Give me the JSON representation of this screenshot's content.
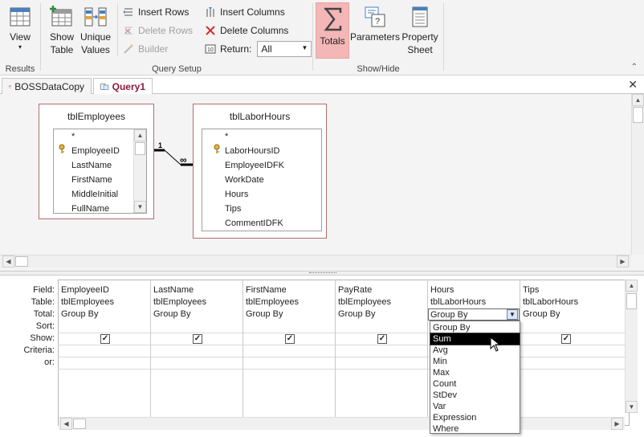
{
  "ribbon": {
    "results": {
      "label": "Results",
      "view": "View"
    },
    "query_setup": {
      "label": "Query Setup",
      "show_table": [
        "Show",
        "Table"
      ],
      "unique_values": [
        "Unique",
        "Values"
      ],
      "insert_rows": "Insert Rows",
      "delete_rows": "Delete Rows",
      "builder": "Builder",
      "insert_columns": "Insert Columns",
      "delete_columns": "Delete Columns",
      "return_label": "Return:",
      "return_value": "All"
    },
    "show_hide": {
      "label": "Show/Hide",
      "totals": "Totals",
      "parameters": "Parameters",
      "property_sheet": [
        "Property",
        "Sheet"
      ]
    }
  },
  "doc_tabs": [
    {
      "label": "BOSSDataCopy",
      "active": false
    },
    {
      "label": "Query1",
      "active": true
    }
  ],
  "tables": [
    {
      "title": "tblEmployees",
      "fields": [
        "*",
        "EmployeeID",
        "LastName",
        "FirstName",
        "MiddleInitial",
        "FullName"
      ],
      "key_field": "EmployeeID"
    },
    {
      "title": "tblLaborHours",
      "fields": [
        "*",
        "LaborHoursID",
        "EmployeeIDFK",
        "WorkDate",
        "Hours",
        "Tips",
        "CommentIDFK"
      ],
      "key_field": "LaborHoursID"
    }
  ],
  "relationship": {
    "one": "1",
    "many": "∞"
  },
  "grid": {
    "row_labels": [
      "Field:",
      "Table:",
      "Total:",
      "Sort:",
      "Show:",
      "Criteria:",
      "or:"
    ],
    "columns": [
      {
        "field": "EmployeeID",
        "table": "tblEmployees",
        "total": "Group By",
        "show": true
      },
      {
        "field": "LastName",
        "table": "tblEmployees",
        "total": "Group By",
        "show": true
      },
      {
        "field": "FirstName",
        "table": "tblEmployees",
        "total": "Group By",
        "show": true
      },
      {
        "field": "PayRate",
        "table": "tblEmployees",
        "total": "Group By",
        "show": true
      },
      {
        "field": "Hours",
        "table": "tblLaborHours",
        "total": "Group By",
        "show": true
      },
      {
        "field": "Tips",
        "table": "tblLaborHours",
        "total": "Group By",
        "show": true
      }
    ]
  },
  "total_dropdown": {
    "options": [
      "Group By",
      "Sum",
      "Avg",
      "Min",
      "Max",
      "Count",
      "StDev",
      "Var",
      "Expression",
      "Where"
    ],
    "highlighted": "Sum"
  },
  "colors": {
    "totals_active": "#f4b6b6",
    "accent": "#8b1a3c",
    "table_border": "#b0706c"
  }
}
